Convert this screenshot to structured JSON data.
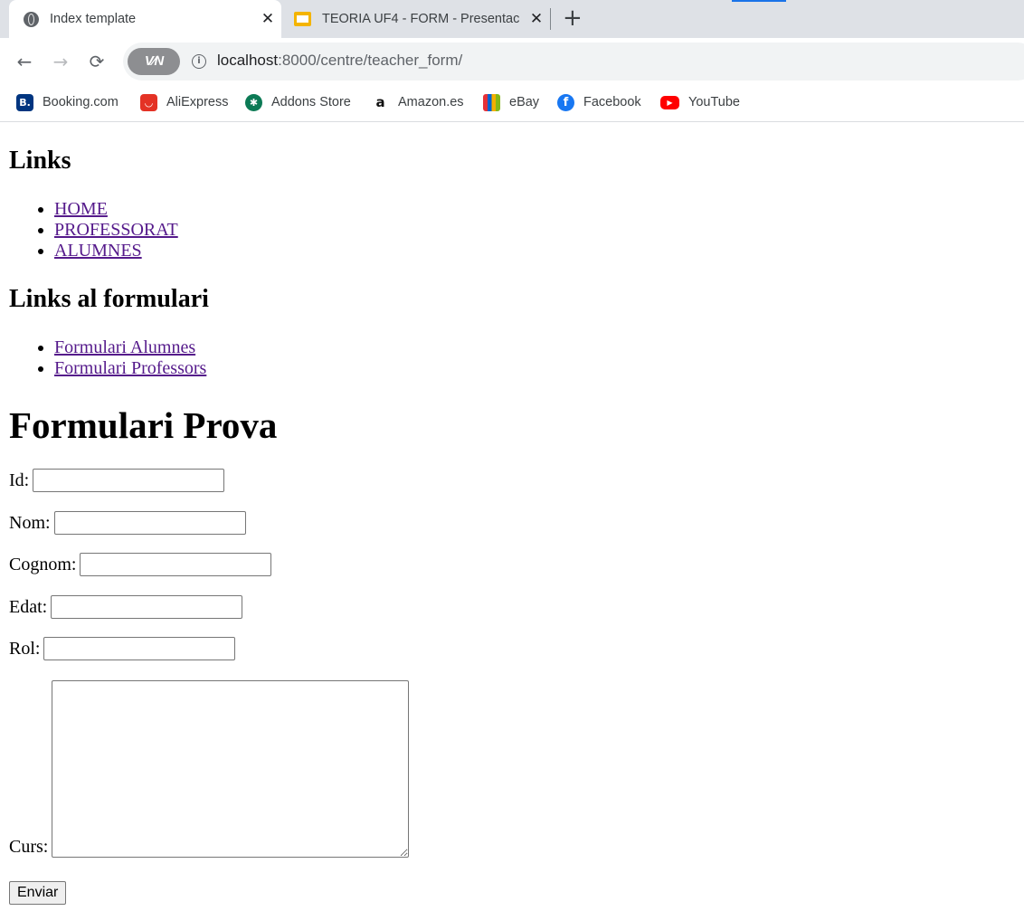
{
  "browser": {
    "tabs": [
      {
        "title": "Index template",
        "favicon": "globe-icon"
      },
      {
        "title": "TEORIA UF4 - FORM - Presentac",
        "favicon": "google-slides-icon"
      }
    ],
    "close_glyph": "✕",
    "newtab_glyph": "+",
    "back_glyph": "←",
    "forward_glyph": "→",
    "reload_glyph": "⟳",
    "vpn_label": "V∕N",
    "info_glyph": "i",
    "url_host": "localhost",
    "url_rest": ":8000/centre/teacher_form/",
    "bookmarks": [
      {
        "label": "Booking.com",
        "glyph": "B."
      },
      {
        "label": "AliExpress",
        "glyph": "◡"
      },
      {
        "label": "Addons Store",
        "glyph": "✱"
      },
      {
        "label": "Amazon.es",
        "glyph": "a"
      },
      {
        "label": "eBay",
        "glyph": ""
      },
      {
        "label": "Facebook",
        "glyph": "f"
      },
      {
        "label": "YouTube",
        "glyph": "▶"
      }
    ]
  },
  "page": {
    "links_heading": "Links",
    "links": [
      "HOME",
      "PROFESSORAT",
      "ALUMNES"
    ],
    "form_links_heading": "Links al formulari",
    "form_links": [
      "Formulari Alumnes",
      "Formulari Professors"
    ],
    "form_title": "Formulari Prova",
    "fields": [
      {
        "label": "Id:",
        "value": ""
      },
      {
        "label": "Nom:",
        "value": ""
      },
      {
        "label": "Cognom:",
        "value": ""
      },
      {
        "label": "Edat:",
        "value": ""
      },
      {
        "label": "Rol:",
        "value": ""
      }
    ],
    "curs_label": "Curs:",
    "curs_value": "",
    "submit_label": "Enviar"
  }
}
